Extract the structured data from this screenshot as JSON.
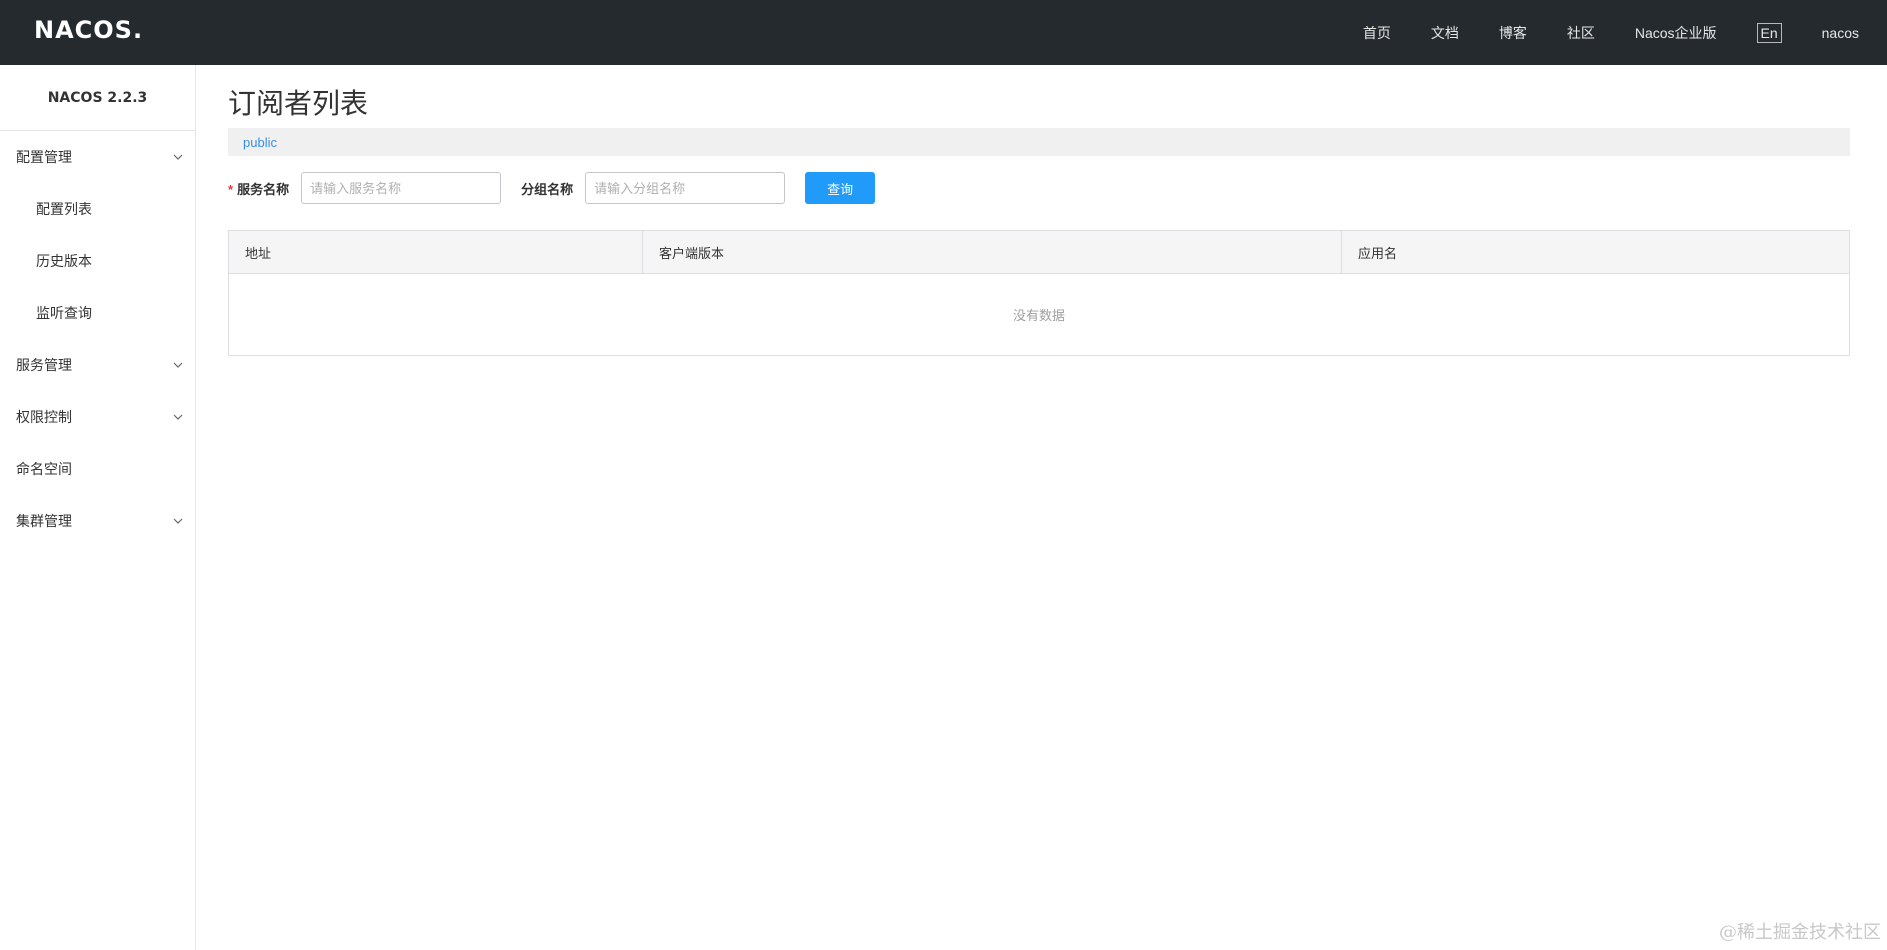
{
  "header": {
    "logo": "NACOS.",
    "nav": [
      "首页",
      "文档",
      "博客",
      "社区",
      "Nacos企业版"
    ],
    "lang_button": "En",
    "user": "nacos"
  },
  "sidebar": {
    "version": "NACOS 2.2.3",
    "groups": [
      {
        "label": "配置管理",
        "expandable": true
      },
      {
        "label": "服务管理",
        "expandable": true
      },
      {
        "label": "权限控制",
        "expandable": true
      },
      {
        "label": "命名空间",
        "expandable": false
      },
      {
        "label": "集群管理",
        "expandable": true
      }
    ],
    "config_items": [
      "配置列表",
      "历史版本",
      "监听查询"
    ]
  },
  "main": {
    "title": "订阅者列表",
    "namespace": "public",
    "form": {
      "required_mark": "*",
      "service_label": "服务名称",
      "service_placeholder": "请输入服务名称",
      "group_label": "分组名称",
      "group_placeholder": "请输入分组名称",
      "query_button": "查询"
    },
    "table": {
      "columns": [
        "地址",
        "客户端版本",
        "应用名"
      ],
      "empty_text": "没有数据"
    }
  },
  "watermark": "@稀土掘金技术社区",
  "colors": {
    "topbar": "#252a2f",
    "primary_button": "#209bfa",
    "link": "#3a8ee6"
  }
}
